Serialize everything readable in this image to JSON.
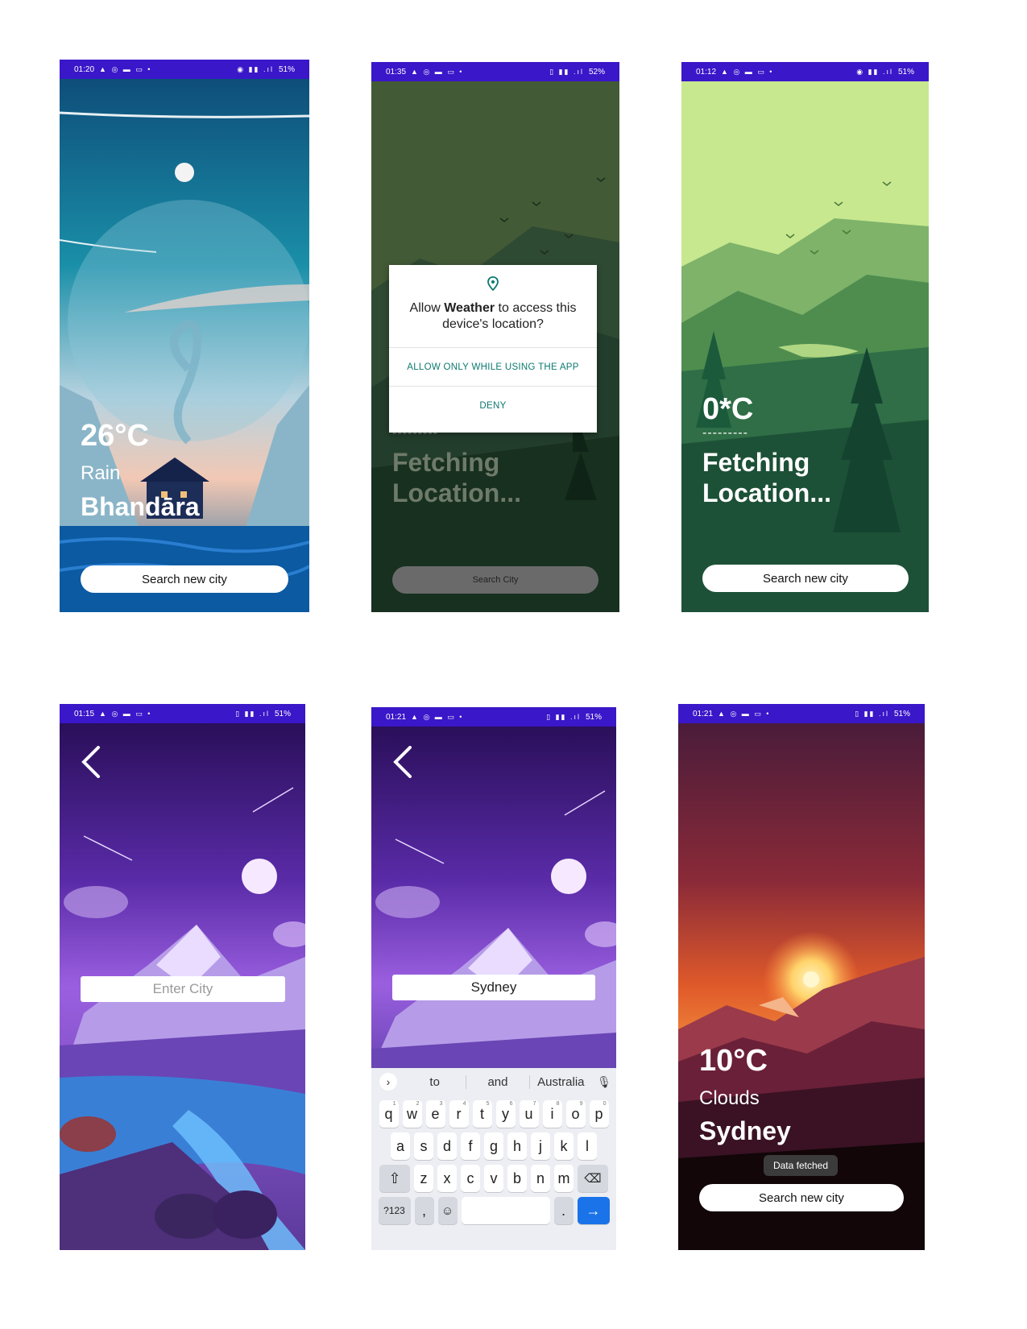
{
  "screens": [
    {
      "status": {
        "time": "01:20",
        "battery": "51%"
      },
      "temperature": "26°C",
      "description": "Rain",
      "city": "Bhandāra",
      "button": "Search new city"
    },
    {
      "status": {
        "time": "01:35",
        "battery": "52%"
      },
      "dialog": {
        "title_prefix": "Allow ",
        "title_app": "Weather",
        "title_suffix": " to access this device's location?",
        "allow": "ALLOW ONLY WHILE USING THE APP",
        "deny": "DENY"
      },
      "dashes": "---------",
      "fetching_line1": "Fetching",
      "fetching_line2": "Location...",
      "button": "Search City"
    },
    {
      "status": {
        "time": "01:12",
        "battery": "51%"
      },
      "temperature": "0*C",
      "dashes": "---------",
      "fetching_line1": "Fetching",
      "fetching_line2": "Location...",
      "button": "Search new city"
    },
    {
      "status": {
        "time": "01:15",
        "battery": "51%"
      },
      "input_placeholder": "Enter City"
    },
    {
      "status": {
        "time": "01:21",
        "battery": "51%"
      },
      "input_value": "Sydney",
      "keyboard": {
        "suggestions": [
          "to",
          "and",
          "Australia"
        ],
        "row1": [
          "q",
          "w",
          "e",
          "r",
          "t",
          "y",
          "u",
          "i",
          "o",
          "p"
        ],
        "row1_nums": [
          "1",
          "2",
          "3",
          "4",
          "5",
          "6",
          "7",
          "8",
          "9",
          "0"
        ],
        "row2": [
          "a",
          "s",
          "d",
          "f",
          "g",
          "h",
          "j",
          "k",
          "l"
        ],
        "row3": [
          "z",
          "x",
          "c",
          "v",
          "b",
          "n",
          "m"
        ],
        "symbols_key": "?123",
        "comma": ",",
        "period": "."
      }
    },
    {
      "status": {
        "time": "01:21",
        "battery": "51%"
      },
      "temperature": "10°C",
      "description": "Clouds",
      "city": "Sydney",
      "toast": "Data fetched",
      "button": "Search new city"
    }
  ],
  "colors": {
    "statusbar": "#3a17c9",
    "dialog_accent": "#0b7a6f",
    "keyboard_enter": "#1a73e8"
  }
}
